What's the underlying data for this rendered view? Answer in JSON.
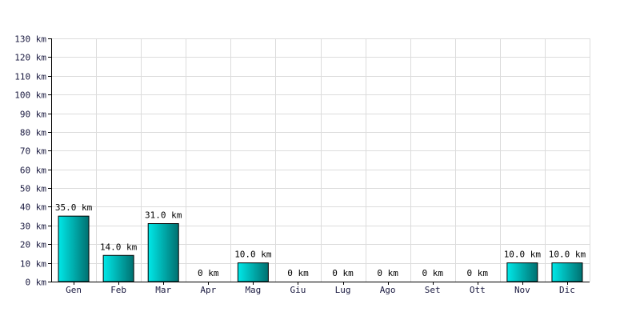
{
  "chart_data": {
    "type": "bar",
    "categories": [
      "Gen",
      "Feb",
      "Mar",
      "Apr",
      "Mag",
      "Giu",
      "Lug",
      "Ago",
      "Set",
      "Ott",
      "Nov",
      "Dic"
    ],
    "values": [
      35.0,
      14.0,
      31.0,
      0,
      10.0,
      0,
      0,
      0,
      0,
      0,
      10.0,
      10.0
    ],
    "data_labels": [
      "35.0 km",
      "14.0 km",
      "31.0 km",
      "0 km",
      "10.0 km",
      "0 km",
      "0 km",
      "0 km",
      "0 km",
      "0 km",
      "10.0 km",
      "10.0 km"
    ],
    "y_ticks": [
      0,
      10,
      20,
      30,
      40,
      50,
      60,
      70,
      80,
      90,
      100,
      110,
      120,
      130
    ],
    "y_tick_labels": [
      "0 km",
      "10 km",
      "20 km",
      "30 km",
      "40 km",
      "50 km",
      "60 km",
      "70 km",
      "80 km",
      "90 km",
      "100 km",
      "110 km",
      "120 km",
      "130 km"
    ],
    "ylim": [
      0,
      130
    ],
    "grid": true,
    "title": "",
    "xlabel": "",
    "ylabel": "",
    "colors": {
      "bar_light": "#00e8e8",
      "bar_dark": "#007070",
      "bar_stroke": "#000000",
      "grid": "#dcdcdc",
      "axis": "#000000"
    }
  }
}
